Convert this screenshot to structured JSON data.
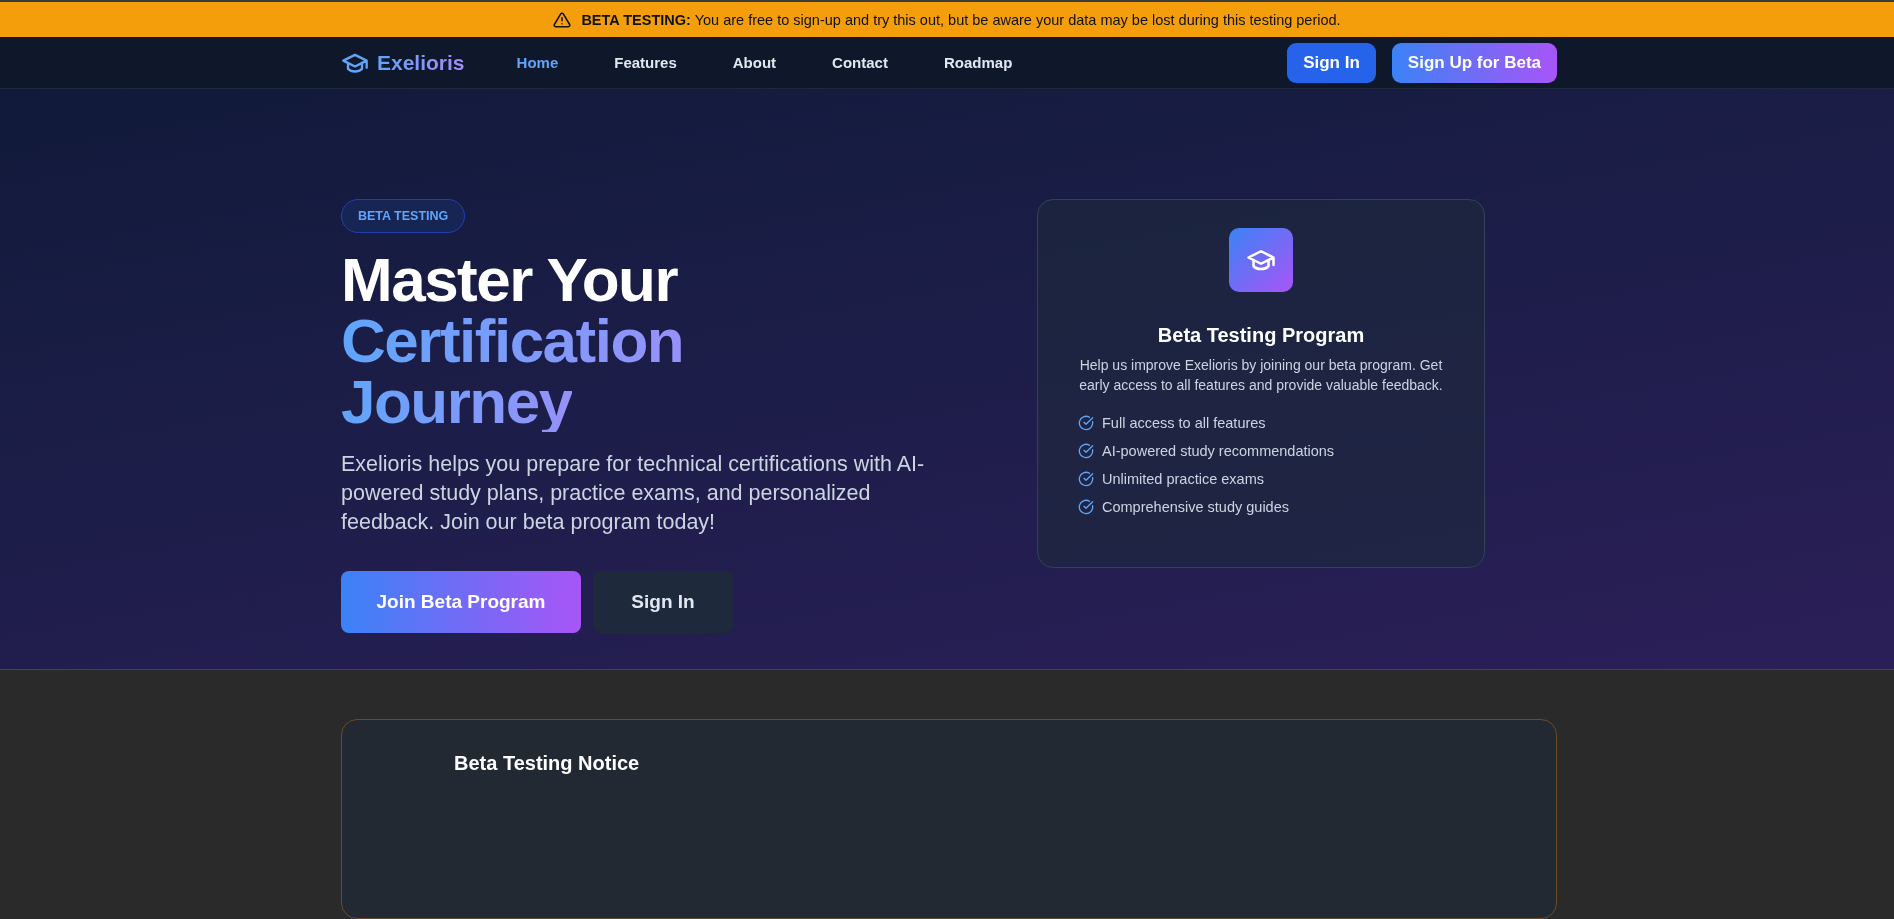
{
  "banner": {
    "label": "BETA TESTING:",
    "message": "You are free to sign-up and try this out, but be aware your data may be lost during this testing period."
  },
  "nav": {
    "brand": "Exelioris",
    "links": [
      {
        "label": "Home",
        "selected": true
      },
      {
        "label": "Features",
        "selected": false
      },
      {
        "label": "About",
        "selected": false
      },
      {
        "label": "Contact",
        "selected": false
      },
      {
        "label": "Roadmap",
        "selected": false
      }
    ],
    "sign_in": "Sign In",
    "sign_up": "Sign Up for Beta"
  },
  "hero": {
    "badge": "BETA TESTING",
    "title_line": "Master Your",
    "title_highlight": [
      "Certification",
      "Journey"
    ],
    "description": "Exelioris helps you prepare for technical certifications with AI-powered study plans, practice exams, and personalized feedback. Join our beta program today!",
    "primary_button": "Join Beta Program",
    "secondary_button": "Sign In"
  },
  "card": {
    "title": "Beta Testing Program",
    "description": "Help us improve Exelioris by joining our beta program. Get early access to all features and provide valuable feedback.",
    "features": [
      "Full access to all features",
      "AI-powered study recommendations",
      "Unlimited practice exams",
      "Comprehensive study guides"
    ]
  },
  "notice": {
    "title": "Beta Testing Notice"
  }
}
